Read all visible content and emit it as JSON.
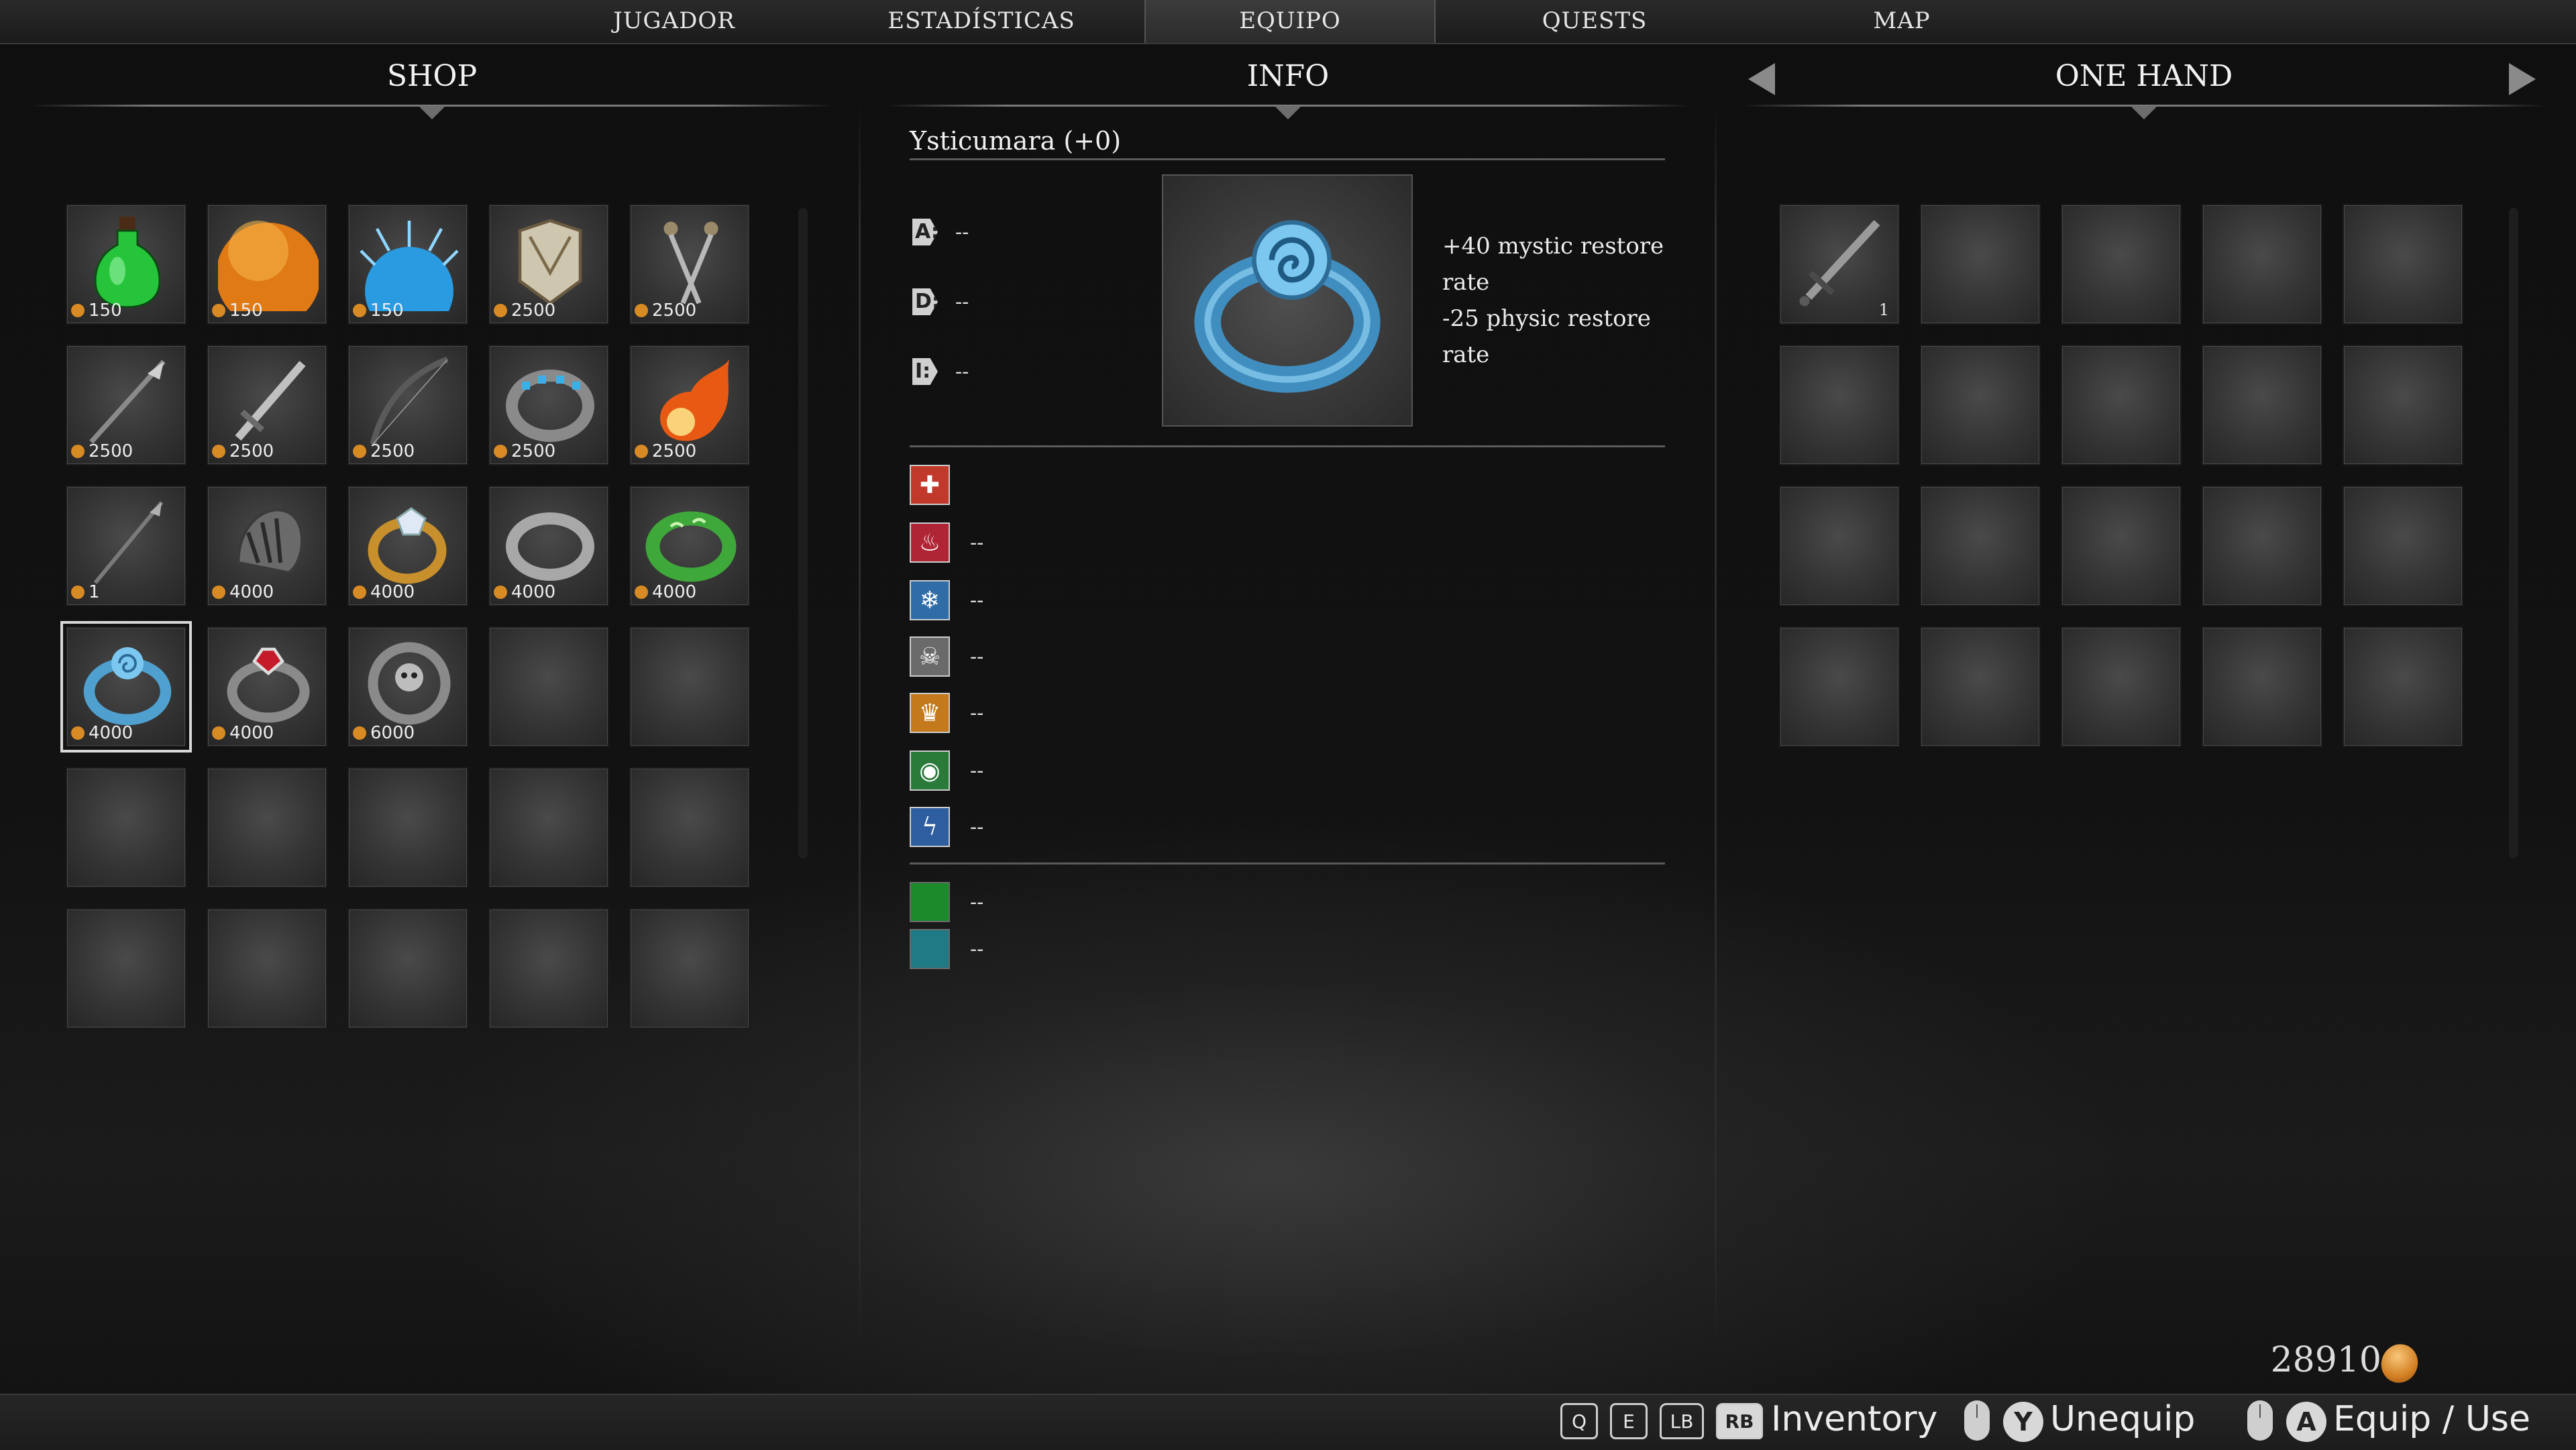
{
  "tabs": [
    {
      "label": "JUGADOR",
      "active": false
    },
    {
      "label": "ESTADÍSTICAS",
      "active": false
    },
    {
      "label": "EQUIPO",
      "active": true
    },
    {
      "label": "QUESTS",
      "active": false
    },
    {
      "label": "MAP",
      "active": false
    }
  ],
  "shop": {
    "title": "SHOP",
    "items": [
      {
        "name": "green-potion",
        "price": "150"
      },
      {
        "name": "orange-orb",
        "price": "150"
      },
      {
        "name": "blue-spiked-orb",
        "price": "150"
      },
      {
        "name": "leather-armor",
        "price": "2500"
      },
      {
        "name": "twin-daggers",
        "price": "2500"
      },
      {
        "name": "spear",
        "price": "2500"
      },
      {
        "name": "greatsword",
        "price": "2500"
      },
      {
        "name": "longbow",
        "price": "2500"
      },
      {
        "name": "gem-studded-ring",
        "price": "2500"
      },
      {
        "name": "fireball",
        "price": "2500"
      },
      {
        "name": "iron-spear",
        "price": "1"
      },
      {
        "name": "claw-ring",
        "price": "4000"
      },
      {
        "name": "gold-diamond-ring",
        "price": "4000"
      },
      {
        "name": "silver-band-ring",
        "price": "4000"
      },
      {
        "name": "green-rune-ring",
        "price": "4000"
      },
      {
        "name": "blue-spiral-ring",
        "price": "4000",
        "selected": true
      },
      {
        "name": "ruby-ring",
        "price": "4000"
      },
      {
        "name": "skull-ring",
        "price": "6000"
      }
    ],
    "total_slots": 30
  },
  "info": {
    "title": "INFO",
    "item_name": "Ysticumara (+0)",
    "stats": [
      {
        "label": "A:",
        "value": "--"
      },
      {
        "label": "D:",
        "value": "--"
      },
      {
        "label": "I:",
        "value": "--"
      }
    ],
    "description_lines": [
      "+40 mystic restore",
      "rate",
      "-25 physic restore",
      "rate"
    ],
    "resistances": [
      {
        "icon": "cross-icon",
        "color": "#c0392b",
        "value": ""
      },
      {
        "icon": "fire-icon",
        "color": "#b02535",
        "value": "--"
      },
      {
        "icon": "snowflake-icon",
        "color": "#2f6ca8",
        "value": "--"
      },
      {
        "icon": "skull-icon",
        "color": "#6a6a6a",
        "value": "--"
      },
      {
        "icon": "crown-icon",
        "color": "#c47a1c",
        "value": "--"
      },
      {
        "icon": "eye-icon",
        "color": "#2a7a3a",
        "value": "--"
      },
      {
        "icon": "lightning-icon",
        "color": "#2f5ea0",
        "value": "--"
      }
    ],
    "extras": [
      {
        "icon": "green-square-icon",
        "color": "#1a8a2a",
        "value": "--"
      },
      {
        "icon": "teal-square-icon",
        "color": "#1f7a86",
        "value": "--"
      }
    ]
  },
  "one_hand": {
    "title": "ONE HAND",
    "items": [
      {
        "name": "sword",
        "count": "1"
      }
    ],
    "total_slots": 20
  },
  "gold": "28910",
  "hints": {
    "key_q": "Q",
    "key_e": "E",
    "key_lb": "LB",
    "key_rb": "RB",
    "inventory": "Inventory",
    "key_y": "Y",
    "unequip": "Unequip",
    "key_a": "A",
    "equip_use": "Equip / Use"
  }
}
